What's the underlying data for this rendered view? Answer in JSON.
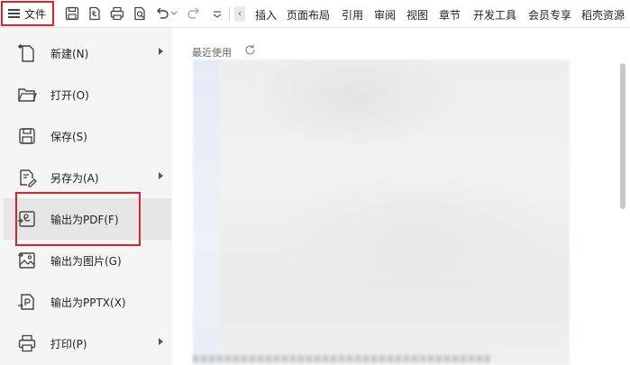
{
  "toolbar": {
    "file_label": "文件",
    "tabs": [
      "插入",
      "页面布局",
      "引用",
      "审阅",
      "视图",
      "章节",
      "开发工具",
      "会员专享",
      "稻壳资源"
    ]
  },
  "menu": {
    "items": [
      {
        "label": "新建(N)",
        "icon": "new-doc-icon",
        "has_submenu": true
      },
      {
        "label": "打开(O)",
        "icon": "folder-open-icon",
        "has_submenu": false
      },
      {
        "label": "保存(S)",
        "icon": "save-icon",
        "has_submenu": false
      },
      {
        "label": "另存为(A)",
        "icon": "save-as-icon",
        "has_submenu": true
      },
      {
        "label": "输出为PDF(F)",
        "icon": "pdf-export-icon",
        "has_submenu": false,
        "active": true
      },
      {
        "label": "输出为图片(G)",
        "icon": "image-export-icon",
        "has_submenu": false
      },
      {
        "label": "输出为PPTX(X)",
        "icon": "pptx-export-icon",
        "has_submenu": false
      },
      {
        "label": "打印(P)",
        "icon": "printer-icon",
        "has_submenu": true
      }
    ]
  },
  "recent": {
    "title": "最近使用"
  },
  "colors": {
    "highlight_red": "#e0202a",
    "menu_bg": "#f5f5f5",
    "active_item_bg": "#e6e6e6"
  }
}
